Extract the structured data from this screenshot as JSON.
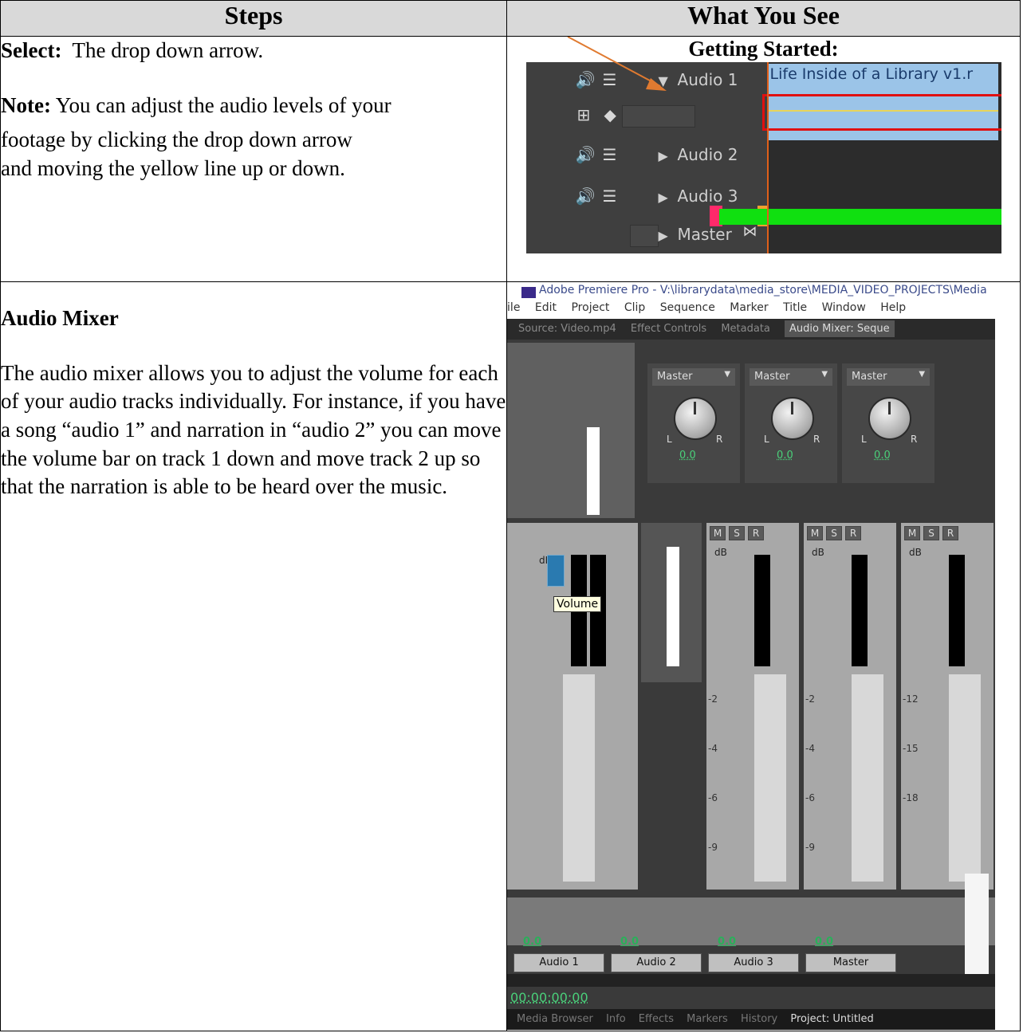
{
  "table": {
    "header_steps": "Steps",
    "header_what": "What You See"
  },
  "row1": {
    "select_label": "Select:",
    "select_text": "The drop down arrow.",
    "note_label": "Note:",
    "note_text": "You can adjust the audio levels of your",
    "note_text2": "footage by clicking the drop down arrow",
    "note_text3": "and moving the yellow line up or down.",
    "shot_title": "Getting Started:",
    "tracks": [
      "Audio 1",
      "Audio 2",
      "Audio 3",
      "Master"
    ],
    "clip_name": "Life Inside of a Library v1.r"
  },
  "row2": {
    "heading": "Audio Mixer",
    "para": "The audio mixer allows you to adjust the volume for each of your audio tracks individually. For instance, if you have a song “audio 1” and narration in “audio 2” you can move the volume bar on track 1 down and move track 2 up so that the narration is able to be heard over the music.",
    "window_title": "Adobe Premiere Pro - V:\\librarydata\\media_store\\MEDIA_VIDEO_PROJECTS\\Media",
    "menu": [
      "ile",
      "Edit",
      "Project",
      "Clip",
      "Sequence",
      "Marker",
      "Title",
      "Window",
      "Help"
    ],
    "panel_tabs": [
      "Source: Video.mp4",
      "Effect Controls",
      "Metadata",
      "Audio Mixer: Seque"
    ],
    "channel_select": "Master",
    "knob_value": "0.0",
    "msr": [
      "M",
      "S",
      "R"
    ],
    "tooltip": "Volume",
    "db_label": "dB",
    "meter_ticks": [
      "-2",
      "-4",
      "-6",
      "-9",
      "-12",
      "-15",
      "-18"
    ],
    "db_values": [
      "0.0",
      "0.0",
      "0.0",
      "0.0"
    ],
    "track_names": [
      "Audio 1",
      "Audio 2",
      "Audio 3",
      "Master"
    ],
    "timecode": "00:00:00:00",
    "bottom_tabs": [
      "Media Browser",
      "Info",
      "Effects",
      "Markers",
      "History",
      "Project: Untitled"
    ]
  }
}
